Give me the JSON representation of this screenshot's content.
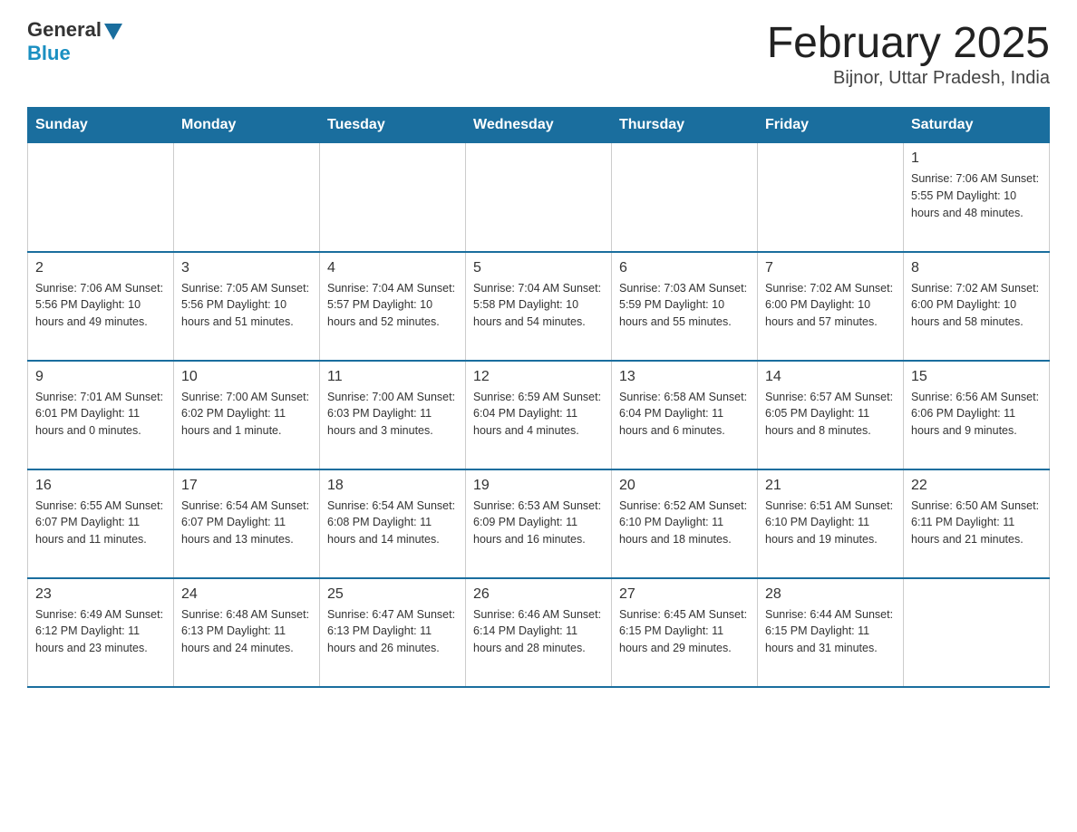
{
  "header": {
    "logo_general": "General",
    "logo_blue": "Blue",
    "title": "February 2025",
    "subtitle": "Bijnor, Uttar Pradesh, India"
  },
  "days_of_week": [
    "Sunday",
    "Monday",
    "Tuesday",
    "Wednesday",
    "Thursday",
    "Friday",
    "Saturday"
  ],
  "weeks": [
    [
      {
        "day": "",
        "info": ""
      },
      {
        "day": "",
        "info": ""
      },
      {
        "day": "",
        "info": ""
      },
      {
        "day": "",
        "info": ""
      },
      {
        "day": "",
        "info": ""
      },
      {
        "day": "",
        "info": ""
      },
      {
        "day": "1",
        "info": "Sunrise: 7:06 AM\nSunset: 5:55 PM\nDaylight: 10 hours and 48 minutes."
      }
    ],
    [
      {
        "day": "2",
        "info": "Sunrise: 7:06 AM\nSunset: 5:56 PM\nDaylight: 10 hours and 49 minutes."
      },
      {
        "day": "3",
        "info": "Sunrise: 7:05 AM\nSunset: 5:56 PM\nDaylight: 10 hours and 51 minutes."
      },
      {
        "day": "4",
        "info": "Sunrise: 7:04 AM\nSunset: 5:57 PM\nDaylight: 10 hours and 52 minutes."
      },
      {
        "day": "5",
        "info": "Sunrise: 7:04 AM\nSunset: 5:58 PM\nDaylight: 10 hours and 54 minutes."
      },
      {
        "day": "6",
        "info": "Sunrise: 7:03 AM\nSunset: 5:59 PM\nDaylight: 10 hours and 55 minutes."
      },
      {
        "day": "7",
        "info": "Sunrise: 7:02 AM\nSunset: 6:00 PM\nDaylight: 10 hours and 57 minutes."
      },
      {
        "day": "8",
        "info": "Sunrise: 7:02 AM\nSunset: 6:00 PM\nDaylight: 10 hours and 58 minutes."
      }
    ],
    [
      {
        "day": "9",
        "info": "Sunrise: 7:01 AM\nSunset: 6:01 PM\nDaylight: 11 hours and 0 minutes."
      },
      {
        "day": "10",
        "info": "Sunrise: 7:00 AM\nSunset: 6:02 PM\nDaylight: 11 hours and 1 minute."
      },
      {
        "day": "11",
        "info": "Sunrise: 7:00 AM\nSunset: 6:03 PM\nDaylight: 11 hours and 3 minutes."
      },
      {
        "day": "12",
        "info": "Sunrise: 6:59 AM\nSunset: 6:04 PM\nDaylight: 11 hours and 4 minutes."
      },
      {
        "day": "13",
        "info": "Sunrise: 6:58 AM\nSunset: 6:04 PM\nDaylight: 11 hours and 6 minutes."
      },
      {
        "day": "14",
        "info": "Sunrise: 6:57 AM\nSunset: 6:05 PM\nDaylight: 11 hours and 8 minutes."
      },
      {
        "day": "15",
        "info": "Sunrise: 6:56 AM\nSunset: 6:06 PM\nDaylight: 11 hours and 9 minutes."
      }
    ],
    [
      {
        "day": "16",
        "info": "Sunrise: 6:55 AM\nSunset: 6:07 PM\nDaylight: 11 hours and 11 minutes."
      },
      {
        "day": "17",
        "info": "Sunrise: 6:54 AM\nSunset: 6:07 PM\nDaylight: 11 hours and 13 minutes."
      },
      {
        "day": "18",
        "info": "Sunrise: 6:54 AM\nSunset: 6:08 PM\nDaylight: 11 hours and 14 minutes."
      },
      {
        "day": "19",
        "info": "Sunrise: 6:53 AM\nSunset: 6:09 PM\nDaylight: 11 hours and 16 minutes."
      },
      {
        "day": "20",
        "info": "Sunrise: 6:52 AM\nSunset: 6:10 PM\nDaylight: 11 hours and 18 minutes."
      },
      {
        "day": "21",
        "info": "Sunrise: 6:51 AM\nSunset: 6:10 PM\nDaylight: 11 hours and 19 minutes."
      },
      {
        "day": "22",
        "info": "Sunrise: 6:50 AM\nSunset: 6:11 PM\nDaylight: 11 hours and 21 minutes."
      }
    ],
    [
      {
        "day": "23",
        "info": "Sunrise: 6:49 AM\nSunset: 6:12 PM\nDaylight: 11 hours and 23 minutes."
      },
      {
        "day": "24",
        "info": "Sunrise: 6:48 AM\nSunset: 6:13 PM\nDaylight: 11 hours and 24 minutes."
      },
      {
        "day": "25",
        "info": "Sunrise: 6:47 AM\nSunset: 6:13 PM\nDaylight: 11 hours and 26 minutes."
      },
      {
        "day": "26",
        "info": "Sunrise: 6:46 AM\nSunset: 6:14 PM\nDaylight: 11 hours and 28 minutes."
      },
      {
        "day": "27",
        "info": "Sunrise: 6:45 AM\nSunset: 6:15 PM\nDaylight: 11 hours and 29 minutes."
      },
      {
        "day": "28",
        "info": "Sunrise: 6:44 AM\nSunset: 6:15 PM\nDaylight: 11 hours and 31 minutes."
      },
      {
        "day": "",
        "info": ""
      }
    ]
  ]
}
